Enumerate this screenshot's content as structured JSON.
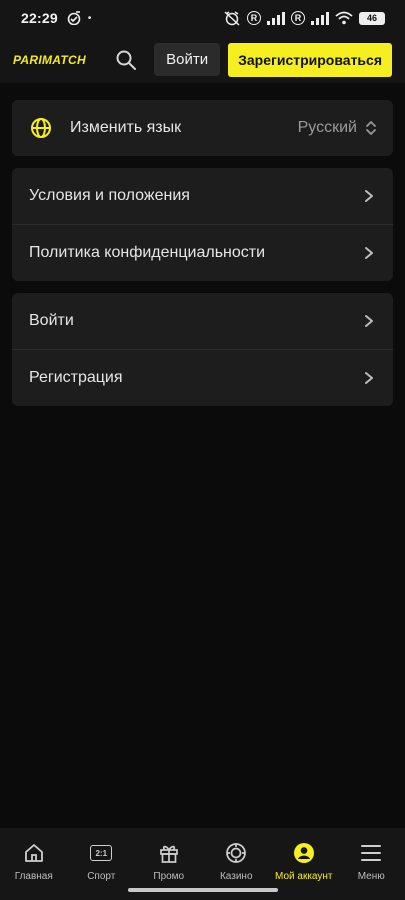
{
  "status_bar": {
    "time": "22:29",
    "dot": "•",
    "r_badge_1": "R",
    "r_badge_2": "R",
    "battery": "46"
  },
  "header": {
    "logo": "PARIMATCH",
    "login_label": "Войти",
    "register_label": "Зарегистрироваться",
    "accent_color": "#f5ef1f"
  },
  "language": {
    "label": "Изменить язык",
    "value": "Русский"
  },
  "legal": {
    "items": [
      {
        "label": "Условия и положения"
      },
      {
        "label": "Политика конфиденциальности"
      }
    ]
  },
  "auth": {
    "items": [
      {
        "label": "Войти"
      },
      {
        "label": "Регистрация"
      }
    ]
  },
  "bottom_nav": {
    "items": [
      {
        "label": "Главная",
        "icon": "home-icon"
      },
      {
        "label": "Спорт",
        "icon": "score-icon",
        "score": "2:1"
      },
      {
        "label": "Промо",
        "icon": "gift-icon"
      },
      {
        "label": "Казино",
        "icon": "chip-icon"
      },
      {
        "label": "Мой аккаунт",
        "icon": "account-icon",
        "active": true
      },
      {
        "label": "Меню",
        "icon": "menu-icon"
      }
    ]
  }
}
